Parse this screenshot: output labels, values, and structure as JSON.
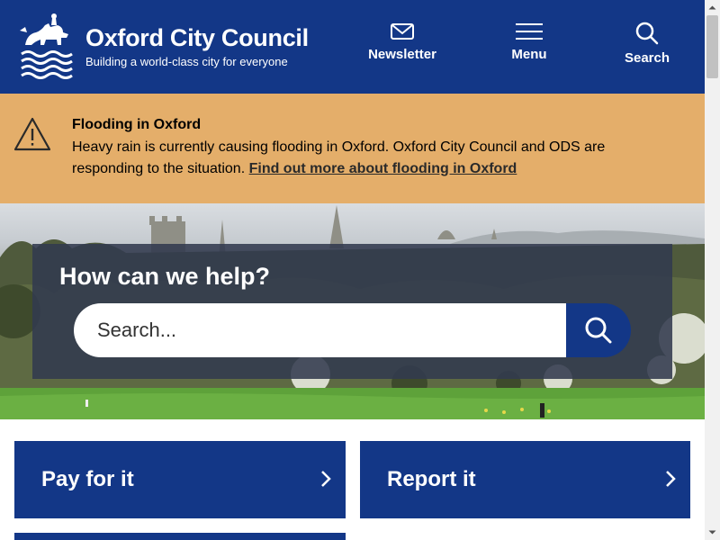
{
  "header": {
    "site_name": "Oxford City Council",
    "tagline": "Building a world-class city for everyone",
    "nav": {
      "newsletter": "Newsletter",
      "menu": "Menu",
      "search": "Search"
    }
  },
  "alert": {
    "title": "Flooding in Oxford",
    "text": "Heavy rain is currently causing flooding in Oxford. Oxford City Council and ODS are responding to the situation.",
    "link": "Find out more about flooding in Oxford"
  },
  "hero": {
    "title": "How can we help?",
    "search_placeholder": "Search..."
  },
  "cards": {
    "pay": "Pay for it",
    "report": "Report it"
  },
  "colors": {
    "brand_blue": "#133787",
    "alert_amber": "#e4ae6a"
  }
}
